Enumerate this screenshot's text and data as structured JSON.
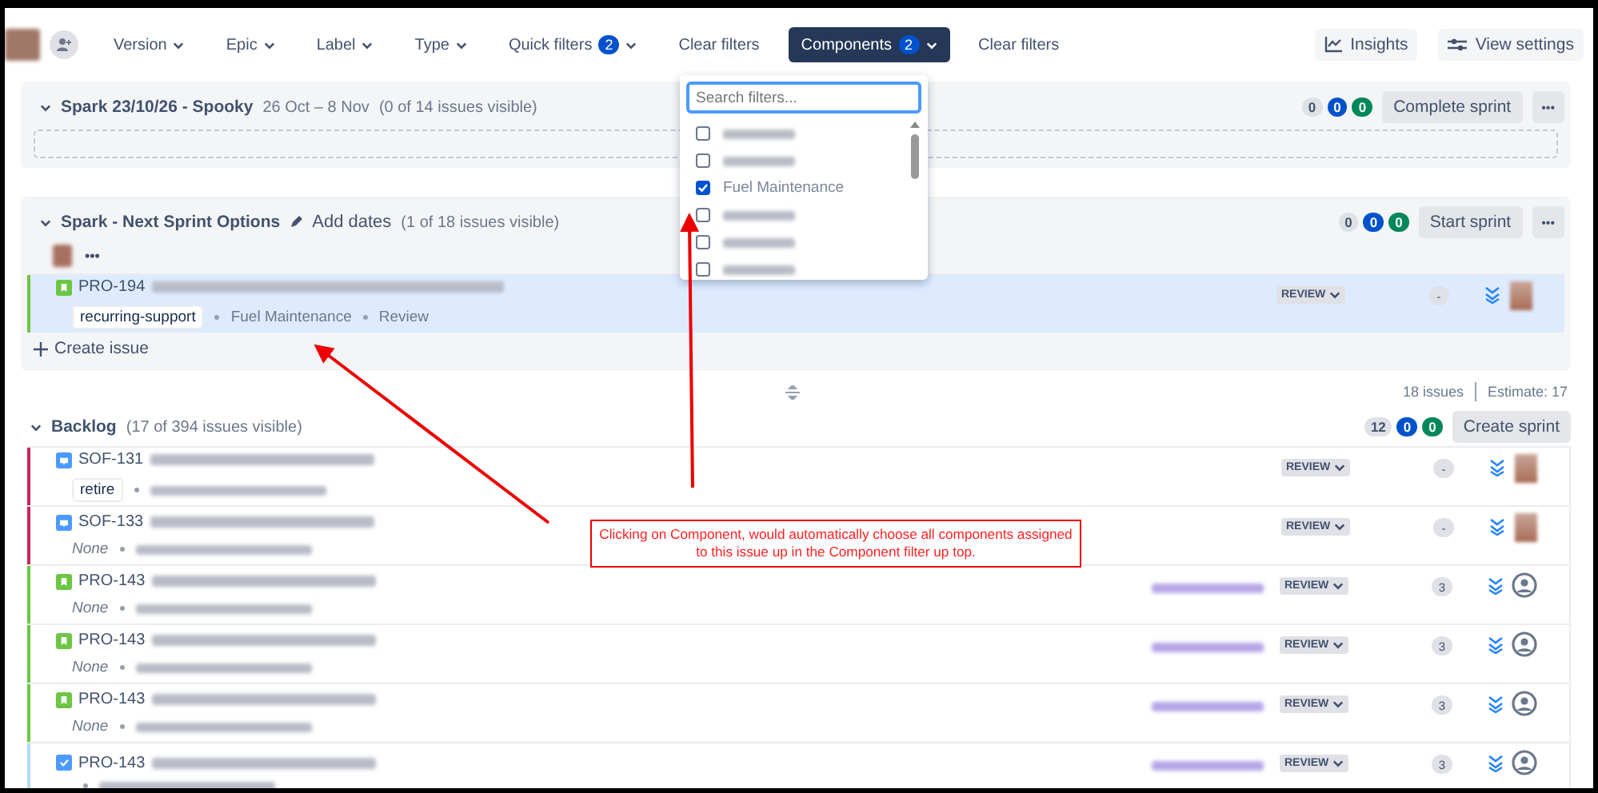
{
  "filters": [
    {
      "label": "Version",
      "kind": "dropdown"
    },
    {
      "label": "Epic",
      "kind": "dropdown"
    },
    {
      "label": "Label",
      "kind": "dropdown"
    },
    {
      "label": "Type",
      "kind": "dropdown"
    },
    {
      "label": "Quick filters",
      "kind": "dropdown",
      "count": "2"
    },
    {
      "label": "Clear filters",
      "kind": "link"
    },
    {
      "label": "Components",
      "kind": "dropdown",
      "count": "2",
      "active": true
    },
    {
      "label": "Clear filters",
      "kind": "link"
    }
  ],
  "actions": [
    {
      "label": "Insights",
      "kind": "insights"
    },
    {
      "label": "View settings",
      "kind": "settings"
    }
  ],
  "component_menu": {
    "placeholder": "Search filters...",
    "options": [
      {
        "checked": false
      },
      {
        "checked": false
      },
      {
        "label": "Fuel Maintenance",
        "checked": true
      },
      {
        "checked": false
      },
      {
        "checked": false
      },
      {
        "checked": false
      }
    ]
  },
  "sprints": [
    {
      "name": "Spark 23/10/26 - Spooky",
      "dates": "26 Oct – 8 Nov",
      "visible": "(0 of 14 issues visible)",
      "counts": [
        "0",
        "0",
        "0"
      ],
      "button": "Complete sprint",
      "more": "•••"
    },
    {
      "name": "Spark - Next Sprint Options",
      "add_dates": "Add dates",
      "visible": "(1 of 18 issues visible)",
      "counts": [
        "0",
        "0",
        "0"
      ],
      "button": "Start sprint",
      "more": "•••",
      "member_more": "•••",
      "create": "Create issue",
      "issues": [
        {
          "key": "PRO-194",
          "kind": "story",
          "color": "#6cc644",
          "selected": true,
          "label": "recurring-support",
          "meta": [
            "Fuel Maintenance",
            "Review"
          ],
          "status": "REVIEW",
          "estimate": "-",
          "assigned": true
        }
      ]
    }
  ],
  "summary": {
    "issues": "18 issues",
    "estimate": "Estimate: 17"
  },
  "backlog": {
    "name": "Backlog",
    "visible": "(17 of 394 issues visible)",
    "counts": [
      "12",
      "0",
      "0"
    ],
    "button": "Create sprint",
    "issues": [
      {
        "key": "SOF-131",
        "kind": "support",
        "color": "#c9245b",
        "selected": false,
        "label": "retire",
        "status": "REVIEW",
        "estimate": "-",
        "assigned": true
      },
      {
        "key": "SOF-133",
        "kind": "support",
        "color": "#c9245b",
        "selected": false,
        "label_placeholder": "None",
        "status": "REVIEW",
        "estimate": "-",
        "assigned": true
      },
      {
        "key": "PRO-143",
        "kind": "story",
        "color": "#6cc644",
        "selected": false,
        "label_placeholder": "None",
        "epic": true,
        "status": "REVIEW",
        "estimate": "3",
        "assigned": false
      },
      {
        "key": "PRO-143",
        "kind": "story",
        "color": "#6cc644",
        "selected": false,
        "label_placeholder": "None",
        "epic": true,
        "status": "REVIEW",
        "estimate": "3",
        "assigned": false
      },
      {
        "key": "PRO-143",
        "kind": "story",
        "color": "#6cc644",
        "selected": false,
        "label_placeholder": "None",
        "epic": true,
        "status": "REVIEW",
        "estimate": "3",
        "assigned": false
      },
      {
        "key": "PRO-143",
        "kind": "task",
        "color": "#b3dcf7",
        "selected": false,
        "epic": true,
        "status": "REVIEW",
        "estimate": "3",
        "assigned": false
      }
    ]
  },
  "annotation": {
    "text": "Clicking on Component, would automatically choose all components assigned to this issue up in the Component filter up top."
  }
}
